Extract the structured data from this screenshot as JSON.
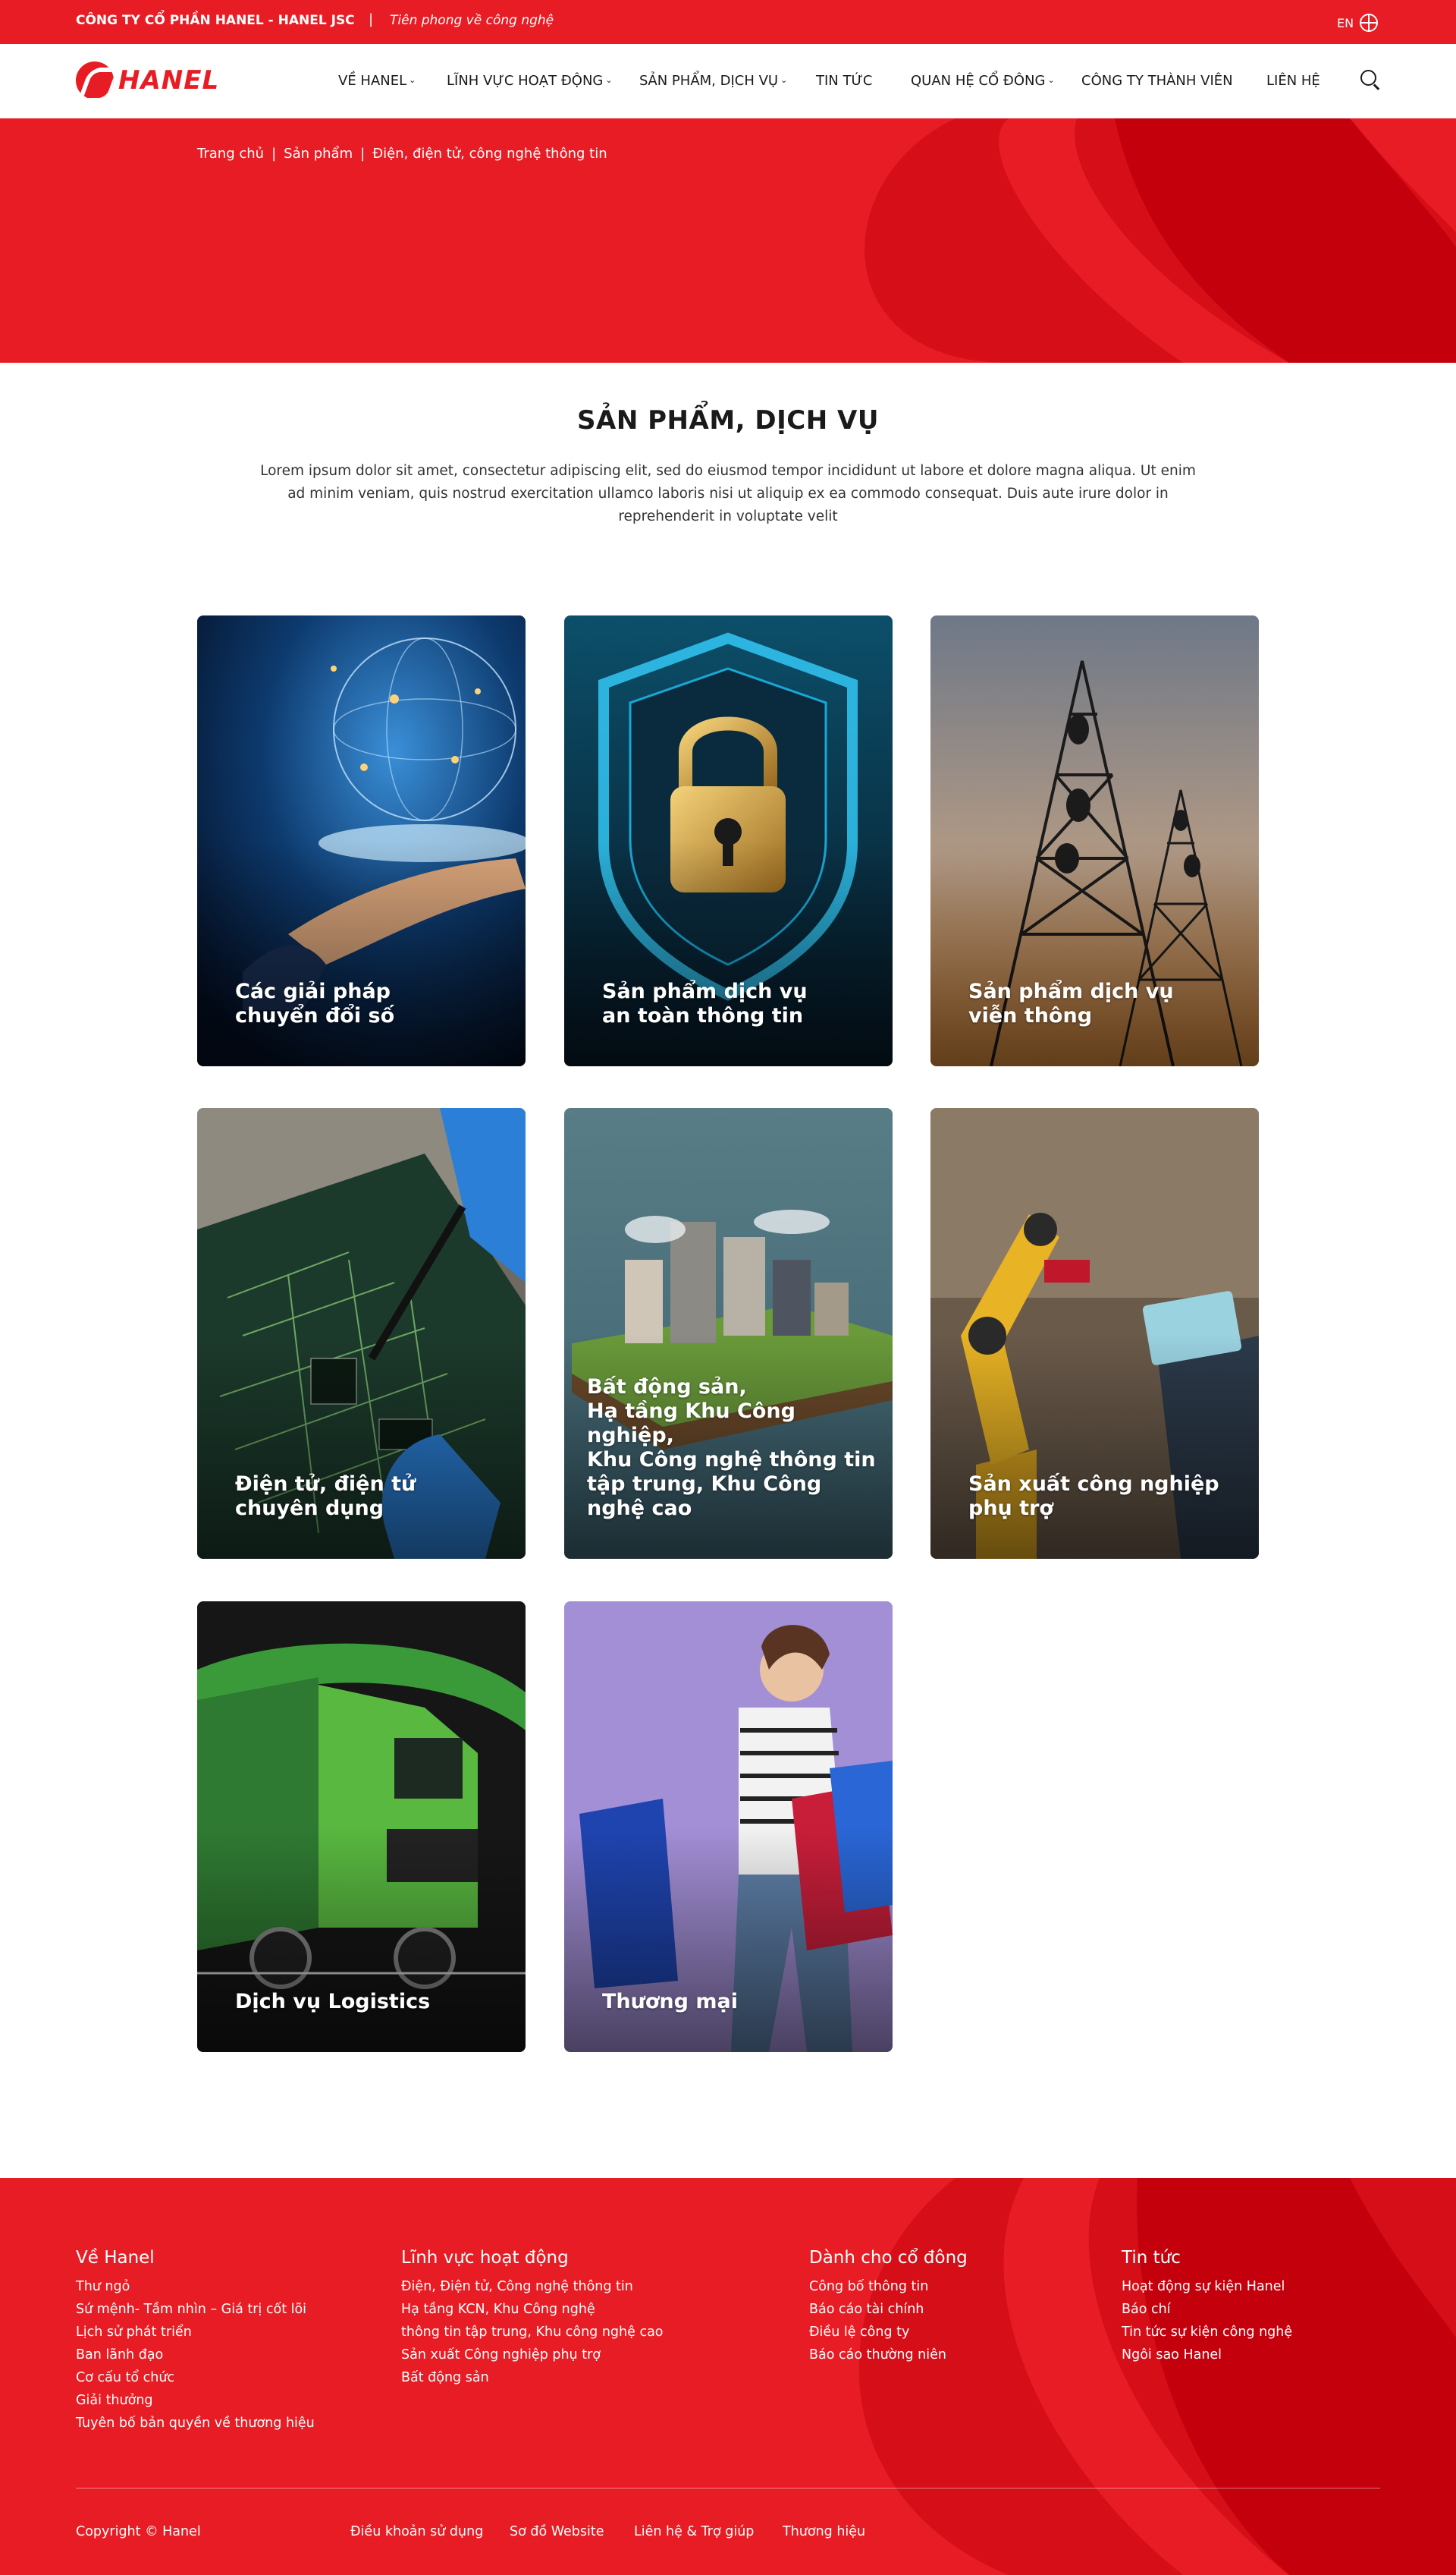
{
  "topbar": {
    "company": "CÔNG TY CỔ PHẦN HANEL - HANEL JSC",
    "separator": "|",
    "tagline": "Tiên phong về công nghệ",
    "lang": "EN",
    "bg_color": "#e81c24"
  },
  "nav": {
    "logo_text": "HANEL",
    "items": [
      {
        "label": "VỀ HANEL",
        "dropdown": true
      },
      {
        "label": "LĨNH VỰC HOẠT ĐỘNG",
        "dropdown": true
      },
      {
        "label": "SẢN PHẨM, DỊCH VỤ",
        "dropdown": true
      },
      {
        "label": "TIN TỨC",
        "dropdown": false
      },
      {
        "label": "QUAN HỆ CỔ ĐÔNG",
        "dropdown": true
      },
      {
        "label": "CÔNG TY THÀNH VIÊN",
        "dropdown": false
      },
      {
        "label": "LIÊN HỆ",
        "dropdown": false
      }
    ],
    "chevron": "⌄",
    "search_icon": "search-icon"
  },
  "breadcrumb": {
    "items": [
      "Trang chủ",
      "Sản phẩm",
      "Điện, điện tử, công nghệ thông tin"
    ],
    "separator": "|"
  },
  "main": {
    "title": "SẢN PHẨM, DỊCH VỤ",
    "intro": "Lorem ipsum dolor sit amet, consectetur adipiscing elit, sed do eiusmod tempor incididunt ut labore et dolore magna aliqua. Ut enim ad minim veniam, quis nostrud exercitation ullamco laboris nisi ut aliquip ex ea commodo consequat. Duis aute irure dolor in reprehenderit in voluptate velit",
    "cards": [
      {
        "title": "Các giải pháp\nchuyển đổi số",
        "scene": "digital-globe"
      },
      {
        "title": "Sản phẩm dịch vụ\nan toàn thông tin",
        "scene": "padlock"
      },
      {
        "title": "Sản phẩm dịch vụ\nviễn thông",
        "scene": "telecom-towers"
      },
      {
        "title": "Điện tử, điện tử\nchuyên dụng",
        "scene": "circuit-board"
      },
      {
        "title": "Bất động sản,\nHạ tầng Khu Công nghiệp,\nKhu Công nghệ thông tin\ntập trung, Khu Công nghệ cao",
        "scene": "floating-city"
      },
      {
        "title": "Sản xuất công nghiệp\nphụ trợ",
        "scene": "robot-arm"
      },
      {
        "title": "Dịch vụ Logistics",
        "scene": "green-truck"
      },
      {
        "title": "Thương mại",
        "scene": "shopping-woman"
      }
    ]
  },
  "footer": {
    "columns": [
      {
        "title": "Về Hanel",
        "links": [
          "Thư ngỏ",
          "Sứ mệnh- Tầm nhìn – Giá trị cốt lõi",
          "Lịch sử phát triển",
          "Ban lãnh đạo",
          "Cơ cấu tổ chức",
          "Giải thưởng",
          "Tuyên bố bản quyền về thương hiệu"
        ]
      },
      {
        "title": "Lĩnh vực hoạt động",
        "links": [
          "Điện, Điện tử, Công nghệ thông tin",
          "Hạ tầng KCN, Khu Công nghệ",
          "thông tin tập trung, Khu công nghệ cao",
          "Sản xuất Công nghiệp phụ trợ",
          "Bất động sản"
        ]
      },
      {
        "title": "Dành cho cổ đông",
        "links": [
          "Công bố thông tin",
          "Báo cáo tài chính",
          "Điều lệ công ty",
          "Báo cáo thường niên"
        ]
      },
      {
        "title": "Tin tức",
        "links": [
          "Hoạt động sự kiện Hanel",
          "Báo chí",
          "Tin tức sự kiện công nghệ",
          "Ngôi sao Hanel"
        ]
      }
    ],
    "copyright": "Copyright © Hanel",
    "bottom_links": [
      "Điều khoản sử dụng",
      "Sơ đồ Website",
      "Liên hệ & Trợ giúp",
      "Thương hiệu"
    ]
  }
}
